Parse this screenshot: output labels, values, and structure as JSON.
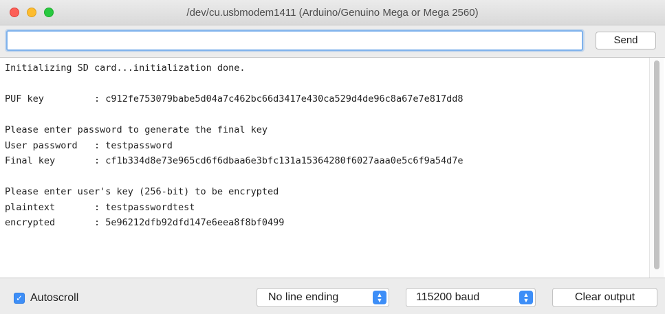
{
  "window": {
    "title": "/dev/cu.usbmodem1411 (Arduino/Genuino Mega or Mega 2560)"
  },
  "input": {
    "value": "",
    "send_label": "Send"
  },
  "console": {
    "lines": [
      "Initializing SD card...initialization done.",
      "",
      "PUF key         : c912fe753079babe5d04a7c462bc66d3417e430ca529d4de96c8a67e7e817dd8",
      "",
      "Please enter password to generate the final key",
      "User password   : testpassword",
      "Final key       : cf1b334d8e73e965cd6f6dbaa6e3bfc131a15364280f6027aaa0e5c6f9a54d7e",
      "",
      "Please enter user's key (256-bit) to be encrypted",
      "plaintext       : testpasswordtest",
      "encrypted       : 5e96212dfb92dfd147e6eea8f8bf0499",
      "",
      ""
    ]
  },
  "bottom": {
    "autoscroll_label": "Autoscroll",
    "autoscroll_checked": true,
    "line_ending": "No line ending",
    "baud": "115200 baud",
    "clear_label": "Clear output"
  },
  "icons": {
    "checkmark": "check-icon",
    "select_arrows": "up-down-arrows-icon"
  },
  "colors": {
    "accent": "#3d8ef7",
    "close": "#fc5f57",
    "minimize": "#fdbc2e",
    "zoom": "#28c940"
  }
}
